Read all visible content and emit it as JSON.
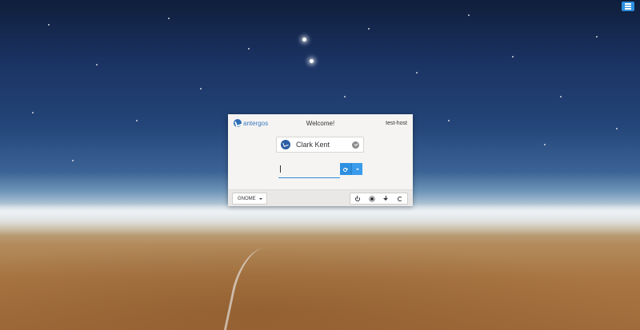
{
  "top_menu": {
    "icon": "hamburger-menu-icon"
  },
  "greeter": {
    "brand": {
      "logo_text": "antergos",
      "icon": "antergos-logo-icon"
    },
    "title": "Welcome!",
    "hostname": "test-host",
    "user": {
      "name": "Clark Kent",
      "avatar_icon": "antergos-avatar-icon",
      "selected_icon": "check-icon"
    },
    "password": {
      "value": "",
      "placeholder": ""
    },
    "login": {
      "icon": "key-icon",
      "dropdown_icon": "caret-down-icon"
    },
    "session": {
      "selected": "GNOME",
      "icon": "caret-down-icon"
    },
    "power_buttons": [
      {
        "name": "shutdown",
        "icon": "power-icon"
      },
      {
        "name": "suspend",
        "icon": "sun-icon"
      },
      {
        "name": "hibernate",
        "icon": "arrow-down-icon"
      },
      {
        "name": "restart",
        "icon": "restart-icon"
      }
    ]
  },
  "colors": {
    "accent": "#2d8fe0",
    "brand": "#2d6db5",
    "dialog_bg": "#f5f4f2",
    "footer_bg": "#e9e8e6"
  }
}
